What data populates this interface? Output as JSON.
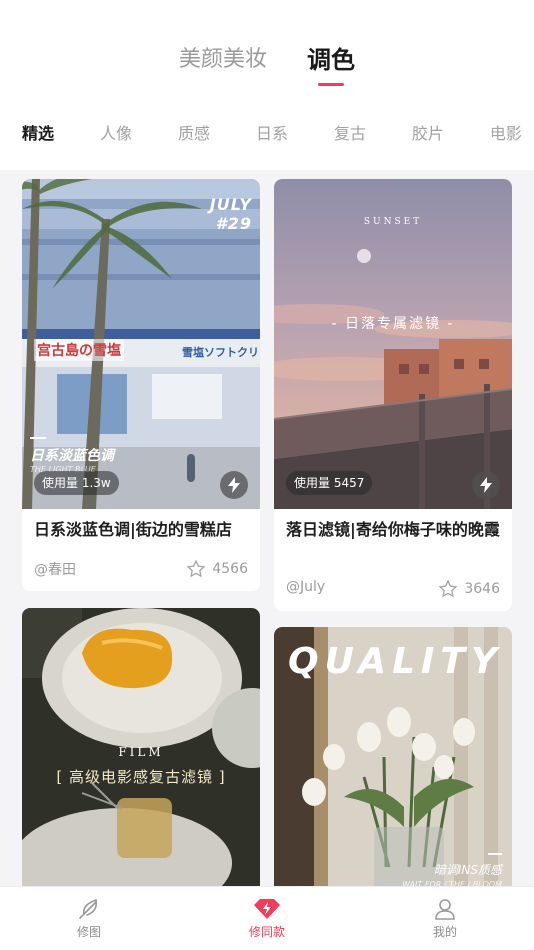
{
  "top_tabs": [
    {
      "label": "美颜美妆",
      "active": false
    },
    {
      "label": "调色",
      "active": true
    }
  ],
  "categories": [
    "精选",
    "人像",
    "质感",
    "日系",
    "复古",
    "胶片",
    "电影"
  ],
  "cards": [
    {
      "title": "日系淡蓝色调|街边的雪糕店",
      "author": "@春田",
      "likes": "4566",
      "usage": "使用量 1.3w",
      "overlay_top": "JULY",
      "overlay_top2": "#29",
      "overlay_caption": "日系淡蓝色调",
      "overlay_sub": "THE LIGHT BLUE",
      "sign_left": "宫古島の雪塩",
      "sign_right": "雪塩ソフトクリ"
    },
    {
      "title": "落日滤镜|寄给你梅子味的晚霞",
      "author": "@July",
      "likes": "3646",
      "usage": "使用量 5457",
      "overlay_top": "SUNSET",
      "overlay_caption": "- 日落专属滤镜 -"
    },
    {
      "overlay_top": "FILM",
      "overlay_caption": "[ 高级电影感复古滤镜 ]"
    },
    {
      "overlay_top": "QUALITY",
      "overlay_caption": "暗调INS质感",
      "overlay_sub": "WAIT FOR / THE / BLOOM"
    }
  ],
  "bottom_nav": [
    {
      "label": "修图",
      "icon": "feather-icon",
      "active": false
    },
    {
      "label": "修同款",
      "icon": "diamond-bolt-icon",
      "active": true
    },
    {
      "label": "我的",
      "icon": "person-icon",
      "active": false
    }
  ],
  "colors": {
    "accent": "#f23c5a",
    "background": "#f4f4f6"
  }
}
